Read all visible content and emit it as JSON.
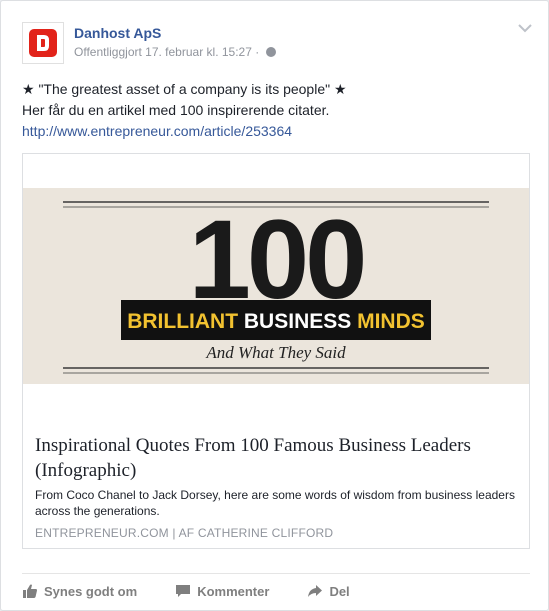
{
  "post": {
    "page_name": "Danhost ApS",
    "meta_text": "Offentliggjort 17. februar kl. 15:27 ·",
    "text_line1": "★ \"The greatest asset of a company is its people\" ★",
    "text_line2": "Her får du en artikel med 100 inspirerende citater.",
    "text_url": "http://www.entrepreneur.com/article/253364"
  },
  "link_preview": {
    "image": {
      "big_number": "100",
      "banner_text_yellow": "BRILLIANT",
      "banner_text_white": "BUSINESS",
      "banner_text_yellow2": "MINDS",
      "subtitle": "And What They Said"
    },
    "title": "Inspirational Quotes From 100 Famous Business Leaders (Infographic)",
    "description": "From Coco Chanel to Jack Dorsey, here are some words of wisdom from business leaders across the generations.",
    "source": "ENTREPRENEUR.COM | AF CATHERINE CLIFFORD"
  },
  "actions": {
    "like": "Synes godt om",
    "comment": "Kommenter",
    "share": "Del"
  },
  "colors": {
    "link_blue": "#365899",
    "danhost_red": "#e2231a",
    "banner_yellow": "#f2c230"
  }
}
